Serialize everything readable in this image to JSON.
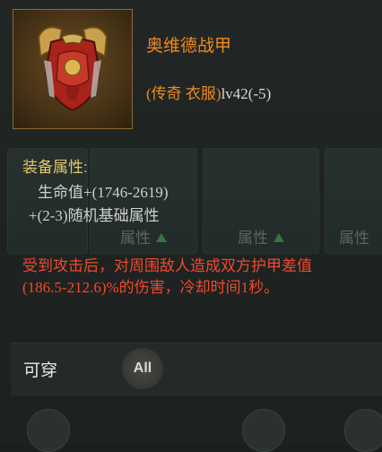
{
  "item": {
    "name": "奥维德战甲",
    "type_prefix": "(传奇 衣服)",
    "level": "lv42(-5)",
    "icon": "armor-breastplate-icon"
  },
  "attributes": {
    "title": "装备属性:",
    "lines": [
      "生命值+(1746-2619)",
      "+(2-3)随机基础属性"
    ]
  },
  "effect": {
    "text": "受到攻击后，对周围敌人造成双方护甲差值(186.5-212.6)%的伤害，冷却时间1秒。"
  },
  "background_cards": [
    {
      "label": "属性"
    },
    {
      "label": "属性"
    },
    {
      "label": "属性"
    }
  ],
  "wear": {
    "label": "可穿",
    "class_badge": "All"
  },
  "colors": {
    "legendary": "#f08a1e",
    "attr_title": "#e3c86a",
    "effect": "#ee4a2c"
  }
}
